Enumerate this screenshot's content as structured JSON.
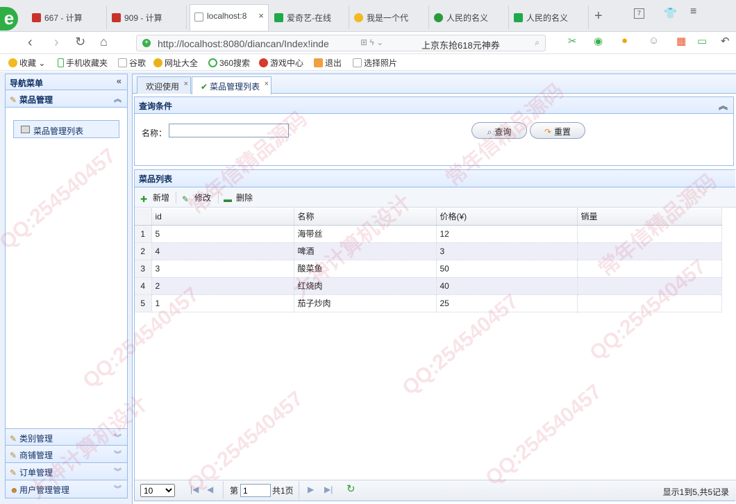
{
  "browser": {
    "tabs": [
      {
        "title": "667 - 计算",
        "icon_color": "#c8322b"
      },
      {
        "title": "909 - 计算",
        "icon_color": "#c8322b"
      },
      {
        "title": "localhost:8",
        "icon_color": "#ffffff",
        "active": true
      },
      {
        "title": "爱奇艺-在线",
        "icon_color": "#20a94b"
      },
      {
        "title": "我是一个代",
        "icon_color": "#f3b920"
      },
      {
        "title": "人民的名义",
        "icon_color": "#2a9a3c"
      },
      {
        "title": "人民的名义",
        "icon_color": "#20a94b"
      }
    ],
    "tab_close": "×",
    "new_tab": "+",
    "tab_count": "7",
    "url": "http://localhost:8080/diancan/Index!inde",
    "promo": "上京东抢618元神券",
    "logo": "e",
    "bookmarks": [
      "收藏",
      "手机收藏夹",
      "谷歌",
      "网址大全",
      "360搜索",
      "游戏中心",
      "退出",
      "选择照片"
    ]
  },
  "sidebar": {
    "title": "导航菜单",
    "sections": [
      {
        "label": "菜品管理",
        "expanded": true,
        "items": [
          {
            "label": "菜品管理列表"
          }
        ]
      },
      {
        "label": "类别管理",
        "expanded": false
      },
      {
        "label": "商铺管理",
        "expanded": false
      },
      {
        "label": "订单管理",
        "expanded": false
      },
      {
        "label": "用户管理管理",
        "expanded": false
      }
    ]
  },
  "tabs": [
    {
      "label": "欢迎使用",
      "active": false
    },
    {
      "label": "菜品管理列表",
      "active": true
    }
  ],
  "query": {
    "title": "查询条件",
    "name_label": "名称：",
    "name_value": "",
    "search_button": "查询",
    "reset_button": "重置"
  },
  "list": {
    "title": "菜品列表",
    "toolbar": {
      "add": "新增",
      "edit": "修改",
      "delete": "删除"
    },
    "columns": [
      "id",
      "名称",
      "价格(¥)",
      "销量"
    ],
    "rows": [
      {
        "rn": "1",
        "id": "5",
        "name": "海带丝",
        "price": "12",
        "sales": ""
      },
      {
        "rn": "2",
        "id": "4",
        "name": "啤酒",
        "price": "3",
        "sales": ""
      },
      {
        "rn": "3",
        "id": "3",
        "name": "酸菜鱼",
        "price": "50",
        "sales": ""
      },
      {
        "rn": "4",
        "id": "2",
        "name": "红烧肉",
        "price": "40",
        "sales": ""
      },
      {
        "rn": "5",
        "id": "1",
        "name": "茄子炒肉",
        "price": "25",
        "sales": ""
      }
    ]
  },
  "pager": {
    "page_size": "10",
    "page_prefix": "第",
    "page_value": "1",
    "page_total": "共1页",
    "info": "显示1到5,共5记录"
  },
  "watermarks": [
    "常年信精品源码",
    "QQ:254540457",
    "大神计算机设计"
  ],
  "colors": {
    "border": "#99bbe8",
    "header": "#e0ecff",
    "accent": "#0e2d5f"
  }
}
